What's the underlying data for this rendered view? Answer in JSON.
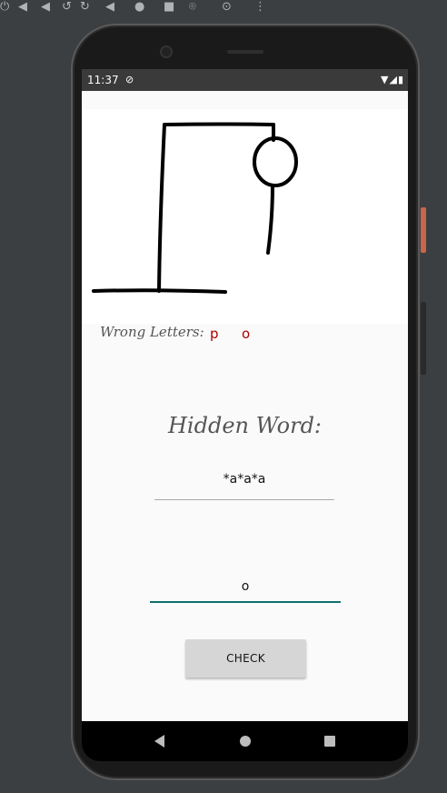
{
  "emulator": {
    "toolbar_icons": [
      "power-icon",
      "volume-up-icon",
      "volume-down-icon",
      "rotate-left-icon",
      "rotate-right-icon",
      "back-icon",
      "home-icon",
      "overview-icon",
      "screenshot-icon",
      "zoom-icon",
      "more-icon"
    ]
  },
  "status": {
    "time": "11:37",
    "sync_icon": "sync-icon",
    "right_icons": [
      "wifi-icon",
      "signal-icon",
      "battery-icon"
    ]
  },
  "game": {
    "wrong_label": "Wrong Letters:",
    "wrong_letters": [
      "p",
      "o"
    ],
    "hidden_title": "Hidden Word:",
    "hidden_word": "*a*a*a",
    "guess_value": "o",
    "check_label": "CHECK"
  },
  "colors": {
    "accent": "#0f7070",
    "wrong_letter": "#b00000",
    "button_bg": "#d6d6d6"
  }
}
